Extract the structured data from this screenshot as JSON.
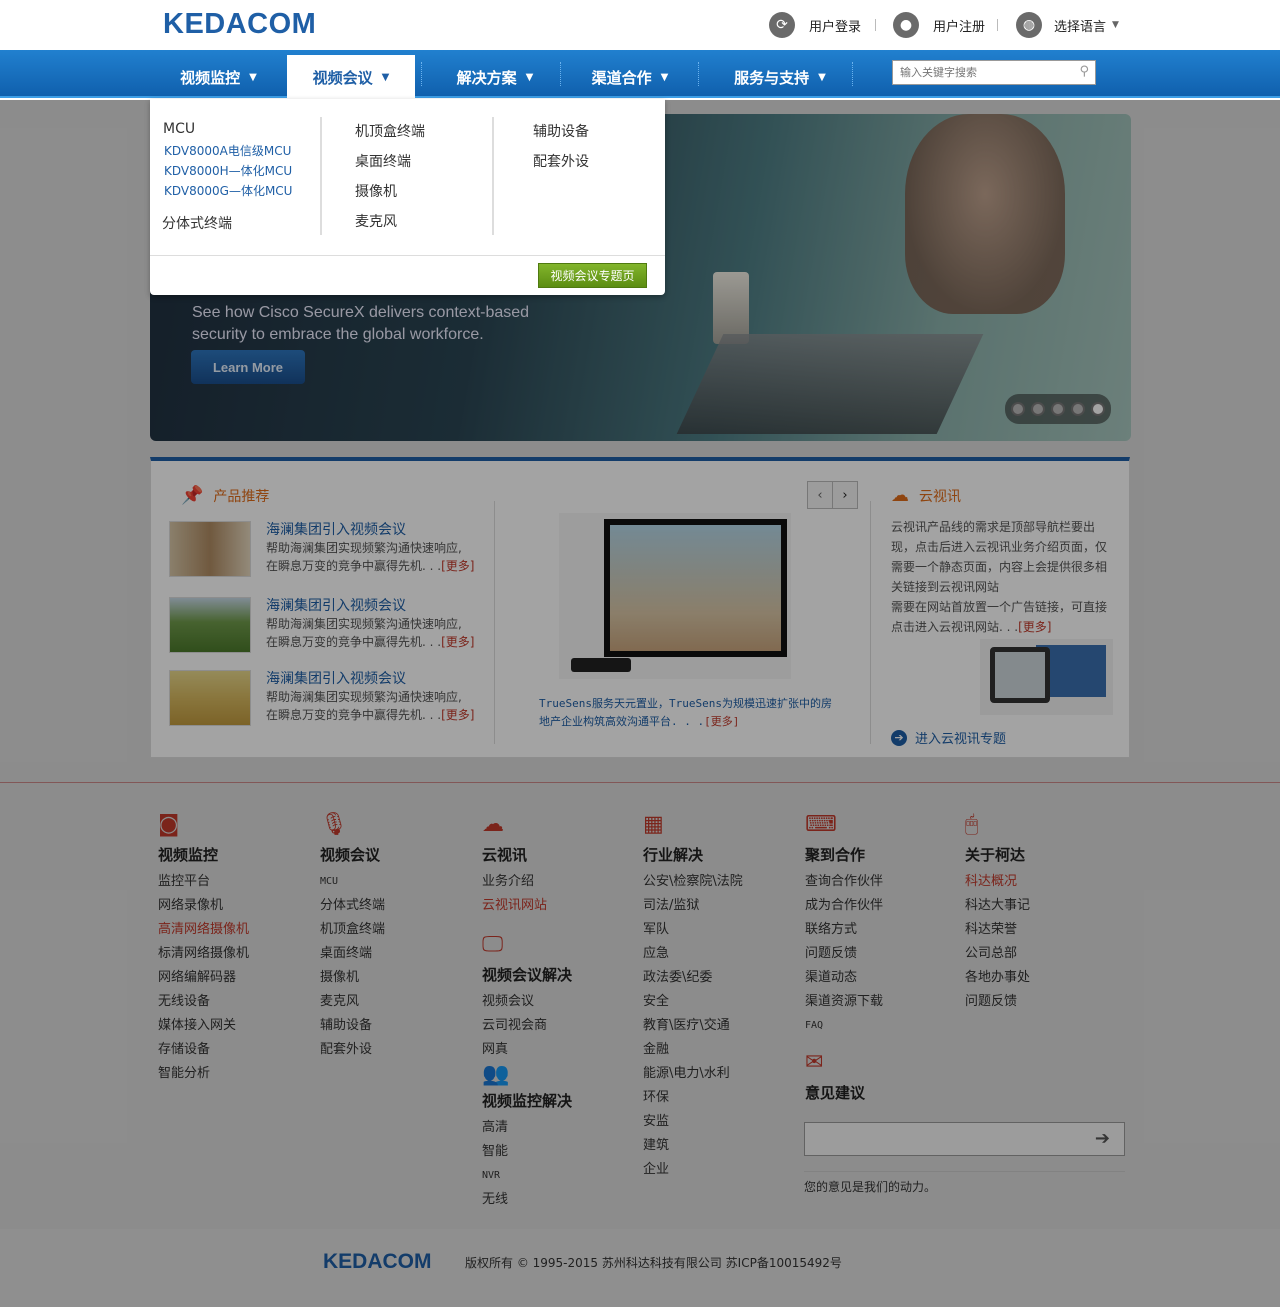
{
  "header": {
    "logo": "KEDACOM",
    "login": "用户登录",
    "register": "用户注册",
    "language": "选择语言"
  },
  "nav": {
    "items": [
      {
        "label": "视频监控"
      },
      {
        "label": "视频会议"
      },
      {
        "label": "解决方案"
      },
      {
        "label": "渠道合作"
      },
      {
        "label": "服务与支持"
      }
    ],
    "active_index": 1,
    "search_placeholder": "输入关键字搜索"
  },
  "dropdown": {
    "col1_heading": "MCU",
    "col1_links": [
      "KDV8000A电信级MCU",
      "KDV8000H—体化MCU",
      "KDV8000G—体化MCU"
    ],
    "col1_item2": "分体式终端",
    "col2_items": [
      "机顶盒终端",
      "桌面终端",
      "摄像机",
      "麦克风"
    ],
    "col3_items": [
      "辅助设备",
      "配套外设"
    ],
    "feature_button": "视频会议专题页"
  },
  "hero": {
    "line1": "See how Cisco SecureX delivers context-based",
    "line2": "security to embrace the global workforce.",
    "button": "Learn More",
    "slide_count": 5,
    "active_slide": 5
  },
  "products": {
    "heading": "产品推荐",
    "items": [
      {
        "title": "海澜集团引入视频会议",
        "desc1": "帮助海澜集团实现频繁沟通快速响应,",
        "desc2": "在瞬息万变的竞争中赢得先机. . .",
        "more": "[更多]"
      },
      {
        "title": "海澜集团引入视频会议",
        "desc1": "帮助海澜集团实现频繁沟通快速响应,",
        "desc2": "在瞬息万变的竞争中赢得先机. . .",
        "more": "[更多]"
      },
      {
        "title": "海澜集团引入视频会议",
        "desc1": "帮助海澜集团实现频繁沟通快速响应,",
        "desc2": "在瞬息万变的竞争中赢得先机. . .",
        "more": "[更多]"
      }
    ],
    "feature_caption1": "TrueSens服务天元置业，TrueSens为规模迅速扩张中的房",
    "feature_caption2": "地产企业构筑高效沟通平台. . .",
    "feature_more": "[更多]"
  },
  "cloud": {
    "heading": "云视讯",
    "desc": "云视讯产品线的需求是顶部导航栏要出现，点击后进入云视讯业务介绍页面，仅需要一个静态页面，内容上会提供很多相关链接到云视讯网站",
    "desc2": "需要在网站首放置一个广告链接，可直接点击进入云视讯网站. . .",
    "more": "[更多]",
    "enter": "进入云视讯专题"
  },
  "footer": {
    "columns": [
      {
        "icon": "cctv-camera-icon",
        "heading": "视频监控",
        "links": [
          "监控平台",
          "网络录像机",
          "高清网络摄像机",
          "标清网络摄像机",
          "网络编解码器",
          "无线设备",
          "媒体接入网关",
          "存储设备",
          "智能分析"
        ],
        "highlight": 2
      },
      {
        "icon": "microphone-icon",
        "heading": "视频会议",
        "links": [
          "MCU",
          "分体式终端",
          "机顶盒终端",
          "桌面终端",
          "摄像机",
          "麦克风",
          "辅助设备",
          "配套外设"
        ],
        "highlight": -1
      },
      {
        "icon": "cloud-icon",
        "heading": "云视讯",
        "links": [
          "业务介绍",
          "云视讯网站"
        ],
        "highlight": 1
      },
      {
        "icon": "grid-icon",
        "heading": "行业解决",
        "links": [
          "公安\\检察院\\法院",
          "司法/监狱",
          "军队",
          "应急",
          "政法委\\纪委",
          "安全",
          "教育\\医疗\\交通",
          "金融",
          "能源\\电力\\水利",
          "环保",
          "安监",
          "建筑",
          "企业"
        ],
        "highlight": -1
      },
      {
        "icon": "keyboard-icon",
        "heading": "聚到合作",
        "links": [
          "查询合作伙伴",
          "成为合作伙伴",
          "联络方式",
          "问题反馈",
          "渠道动态",
          "渠道资源下载",
          "FAQ"
        ],
        "highlight": -1
      },
      {
        "icon": "mouse-icon",
        "heading": "关于柯达",
        "links": [
          "科达概况",
          "科达大事记",
          "科达荣誉",
          "公司总部",
          "各地办事处",
          "问题反馈"
        ],
        "highlight": 0
      }
    ],
    "vc_solutions": {
      "icon": "monitor-icon",
      "heading": "视频会议解决",
      "links": [
        "视频会议",
        "云司视会商",
        "网真"
      ]
    },
    "mon_solutions": {
      "icon": "people-icon",
      "heading": "视频监控解决",
      "links": [
        "高清",
        "智能",
        "NVR",
        "无线"
      ]
    },
    "feedback": {
      "icon": "mail-icon",
      "heading": "意见建议",
      "note": "您的意见是我们的动力。"
    },
    "logo": "KEDACOM",
    "copyright": "版权所有 © 1995-2015 苏州科达科技有限公司 苏ICP备10015492号"
  },
  "colors": {
    "brand_blue": "#1f5fa6",
    "accent_orange": "#e06c1a",
    "accent_red": "#c0392b",
    "button_green": "#6f9f1e"
  }
}
